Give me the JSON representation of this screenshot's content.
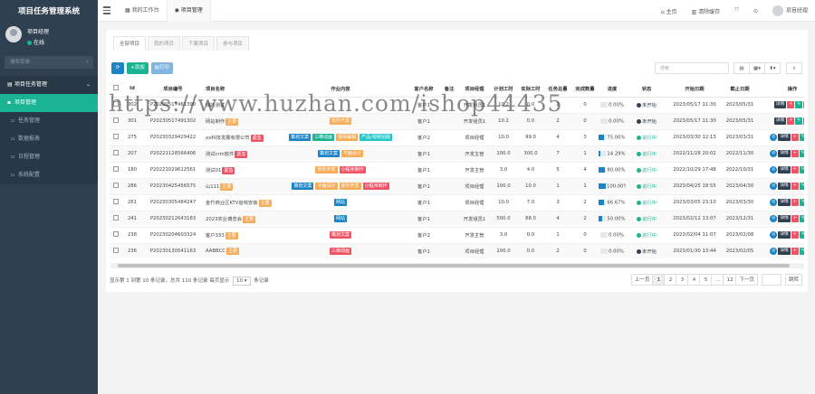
{
  "app": {
    "title": "项目任务管理系统"
  },
  "user": {
    "name": "项目经理",
    "status": "在线"
  },
  "sidebar": {
    "search_placeholder": "搜索菜单",
    "items": [
      {
        "label": "项目任务管理",
        "arrow": "⌄"
      },
      {
        "label": "项目管理"
      },
      {
        "label": "任务管理"
      },
      {
        "label": "数据报表"
      },
      {
        "label": "日程管理"
      },
      {
        "label": "系统配置"
      }
    ]
  },
  "topbar": {
    "tabs": [
      {
        "label": "我的工作台"
      },
      {
        "label": "项目管理"
      }
    ],
    "home": "主页",
    "clear_cache": "清除缓存",
    "user": "项目经理"
  },
  "subtabs": [
    "全部项目",
    "我的项目",
    "下属项目",
    "参与项目"
  ],
  "toolbar": {
    "add": "添加",
    "print": "打印",
    "search_placeholder": "搜索"
  },
  "table": {
    "headers": [
      "Id",
      "项目编号",
      "项目名称",
      "作业内容",
      "客户名称",
      "备注",
      "项目经理",
      "计划工时",
      "实际工时",
      "任务总量",
      "完成数量",
      "进度",
      "状态",
      "开始日期",
      "截止日期",
      "操作"
    ],
    "rows": [
      {
        "id": "302",
        "code": "P20230517461390",
        "name": "我的测试",
        "name_tags": [],
        "jobs": [],
        "client": "客户1",
        "remark": "",
        "manager": "开发组员1",
        "plan": "10.2",
        "actual": "0.0",
        "total": "2",
        "done": "0",
        "progress": 0,
        "progress_text": "0.00%",
        "status": "未开始",
        "status_color": "#2f4050",
        "start": "2023/05/17 11:30",
        "end": "2023/05/31"
      },
      {
        "id": "301",
        "code": "P20230517491302",
        "name": "网站制作",
        "name_tags": [
          {
            "t": "主要",
            "c": "orange"
          }
        ],
        "jobs": [
          {
            "t": "软件开发",
            "c": "orange"
          }
        ],
        "client": "客户1",
        "remark": "",
        "manager": "开发组员1",
        "plan": "10.2",
        "actual": "0.0",
        "total": "2",
        "done": "0",
        "progress": 0,
        "progress_text": "0.00%",
        "status": "未开始",
        "status_color": "#2f4050",
        "start": "2023/05/17 11:30",
        "end": "2023/05/31"
      },
      {
        "id": "275",
        "code": "P20230329429422",
        "name": "xx科技发展有限公司",
        "name_tags": [
          {
            "t": "紧急",
            "c": "red"
          }
        ],
        "jobs": [
          {
            "t": "策划文案",
            "c": "blue"
          },
          {
            "t": "三维动画",
            "c": "green"
          },
          {
            "t": "视频编辑",
            "c": "orange"
          },
          {
            "t": "产品/视频拍摄",
            "c": "cyan"
          }
        ],
        "client": "客户2",
        "remark": "",
        "manager": "项目经理",
        "plan": "10.0",
        "actual": "99.0",
        "total": "4",
        "done": "3",
        "progress": 75,
        "progress_text": "75.00%",
        "status": "进行中",
        "status_color": "#1ab394",
        "start": "2023/03/30 12:13",
        "end": "2023/03/31"
      },
      {
        "id": "207",
        "code": "P20221128566406",
        "name": "测试crm软件",
        "name_tags": [
          {
            "t": "紧急",
            "c": "red"
          }
        ],
        "jobs": [
          {
            "t": "策划文案",
            "c": "blue"
          },
          {
            "t": "平面设计",
            "c": "orange"
          }
        ],
        "client": "客户1",
        "remark": "",
        "manager": "开发主管",
        "plan": "100.0",
        "actual": "300.0",
        "total": "7",
        "done": "1",
        "progress": 14.29,
        "progress_text": "14.29%",
        "status": "进行中",
        "status_color": "#1ab394",
        "start": "2022/11/28 20:02",
        "end": "2022/11/30"
      },
      {
        "id": "180",
        "code": "P20221029612561",
        "name": "测试01",
        "name_tags": [
          {
            "t": "紧急",
            "c": "red"
          }
        ],
        "jobs": [
          {
            "t": "软件开发",
            "c": "orange"
          },
          {
            "t": "小程序制作",
            "c": "red"
          }
        ],
        "client": "客户1",
        "remark": "",
        "manager": "开发主管",
        "plan": "3.0",
        "actual": "4.0",
        "total": "5",
        "done": "4",
        "progress": 80,
        "progress_text": "80.00%",
        "status": "进行中",
        "status_color": "#1ab394",
        "start": "2022/10/29 17:48",
        "end": "2022/10/31"
      },
      {
        "id": "286",
        "code": "P20230425456575",
        "name": "山111",
        "name_tags": [
          {
            "t": "主要",
            "c": "orange"
          }
        ],
        "jobs": [
          {
            "t": "策划文案",
            "c": "blue"
          },
          {
            "t": "平面设计",
            "c": "orange"
          },
          {
            "t": "软件开发",
            "c": "orange"
          },
          {
            "t": "小程序制作",
            "c": "red"
          }
        ],
        "client": "客户1",
        "remark": "",
        "manager": "项目经理",
        "plan": "100.0",
        "actual": "10.0",
        "total": "1",
        "done": "1",
        "progress": 100,
        "progress_text": "100.00%",
        "status": "进行中",
        "status_color": "#1ab394",
        "start": "2023/04/25 18:55",
        "end": "2023/04/30"
      },
      {
        "id": "261",
        "code": "P20230305484247",
        "name": "金竹商业区KTV音响安装",
        "name_tags": [
          {
            "t": "主要",
            "c": "orange"
          }
        ],
        "jobs": [
          {
            "t": "网站",
            "c": "blue"
          }
        ],
        "client": "客户1",
        "remark": "",
        "manager": "项目经理",
        "plan": "10.0",
        "actual": "7.0",
        "total": "3",
        "done": "2",
        "progress": 66.67,
        "progress_text": "66.67%",
        "status": "进行中",
        "status_color": "#1ab394",
        "start": "2023/03/05 23:10",
        "end": "2023/03/30"
      },
      {
        "id": "241",
        "code": "P20230212643183",
        "name": "2023农业博览会",
        "name_tags": [
          {
            "t": "主要",
            "c": "orange"
          }
        ],
        "jobs": [
          {
            "t": "网站",
            "c": "blue"
          }
        ],
        "client": "客户1",
        "remark": "",
        "manager": "开发组员1",
        "plan": "500.0",
        "actual": "88.0",
        "total": "4",
        "done": "2",
        "progress": 50,
        "progress_text": "50.00%",
        "status": "进行中",
        "status_color": "#1ab394",
        "start": "2023/02/12 13:07",
        "end": "2023/12/31"
      },
      {
        "id": "238",
        "code": "P20230204603324",
        "name": "客户333",
        "name_tags": [
          {
            "t": "主要",
            "c": "orange"
          }
        ],
        "jobs": [
          {
            "t": "策划文案",
            "c": "red"
          }
        ],
        "client": "客户2",
        "remark": "",
        "manager": "开发主管",
        "plan": "3.0",
        "actual": "0.0",
        "total": "1",
        "done": "0",
        "progress": 0,
        "progress_text": "0.00%",
        "status": "进行中",
        "status_color": "#1ab394",
        "start": "2023/02/04 11:07",
        "end": "2023/02/08"
      },
      {
        "id": "236",
        "code": "P20230130541163",
        "name": "AABBCC",
        "name_tags": [
          {
            "t": "主要",
            "c": "orange"
          }
        ],
        "jobs": [
          {
            "t": "三维动画",
            "c": "red"
          }
        ],
        "client": "客户1",
        "remark": "",
        "manager": "项目经理",
        "plan": "100.0",
        "actual": "0.0",
        "total": "2",
        "done": "0",
        "progress": 0,
        "progress_text": "0.00%",
        "status": "未开始",
        "status_color": "#2f4050",
        "start": "2023/01/30 13:44",
        "end": "2023/02/05"
      }
    ],
    "actions": {
      "detail": "详情"
    }
  },
  "footer": {
    "info_prefix": "显示第 1 到第 10 条记录，总共 110 条记录 每页显示",
    "page_size": "10",
    "info_suffix": "条记录"
  },
  "pager": {
    "prev": "上一页",
    "pages": [
      "1",
      "2",
      "3",
      "4",
      "5",
      "...",
      "12"
    ],
    "next": "下一页",
    "go": "跳转"
  },
  "watermark": "https://www.huzhan.com/ishop44435"
}
